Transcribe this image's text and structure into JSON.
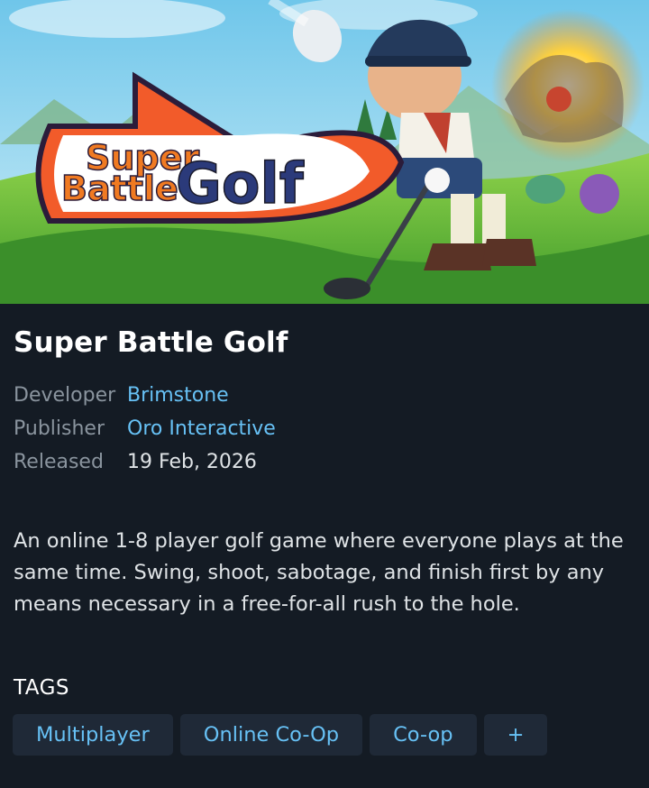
{
  "game": {
    "title": "Super Battle Golf",
    "logo_line1": "Super",
    "logo_line2": "Battle",
    "logo_line3": "Golf"
  },
  "details": {
    "developer_label": "Developer",
    "developer": "Brimstone",
    "publisher_label": "Publisher",
    "publisher": "Oro Interactive",
    "released_label": "Released",
    "released": "19 Feb, 2026"
  },
  "description": "An online 1-8 player golf game where everyone plays at the same time. Swing, shoot, sabotage, and finish first by any means necessary in a free-for-all rush to the hole.",
  "tags": {
    "heading": "TAGS",
    "items": [
      "Multiplayer",
      "Online Co-Op",
      "Co-op"
    ],
    "more_label": "+"
  },
  "colors": {
    "background": "#141b24",
    "link": "#67c1f5",
    "tag_bg": "#1f2937",
    "label": "#8a949e"
  }
}
